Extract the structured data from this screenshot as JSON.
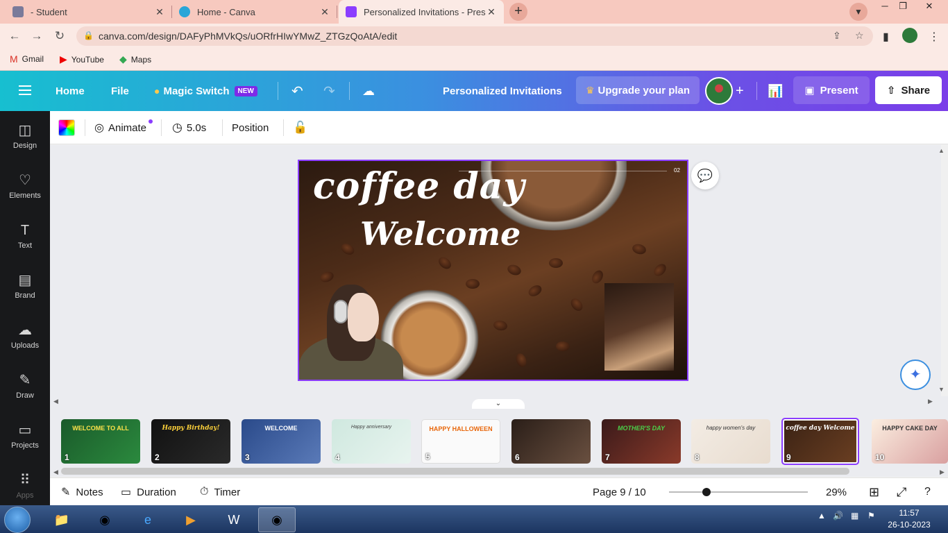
{
  "browser": {
    "tabs": [
      {
        "title": "- Student",
        "close": "✕"
      },
      {
        "title": "Home - Canva",
        "close": "✕"
      },
      {
        "title": "Personalized Invitations - Present",
        "close": "✕"
      }
    ],
    "new_tab": "+",
    "url": "canva.com/design/DAFyPhMVkQs/uORfrHIwYMwZ_ZTGzQoAtA/edit",
    "bookmarks": [
      "Gmail",
      "YouTube",
      "Maps"
    ]
  },
  "topbar": {
    "home": "Home",
    "file": "File",
    "magic_switch": "Magic Switch",
    "new_badge": "NEW",
    "doc_title": "Personalized Invitations",
    "upgrade": "Upgrade your plan",
    "plus": "+",
    "present": "Present",
    "share": "Share"
  },
  "sidebar": {
    "items": [
      {
        "label": "Design",
        "icon": "design-icon"
      },
      {
        "label": "Elements",
        "icon": "elements-icon"
      },
      {
        "label": "Text",
        "icon": "text-icon"
      },
      {
        "label": "Brand",
        "icon": "brand-icon"
      },
      {
        "label": "Uploads",
        "icon": "uploads-icon"
      },
      {
        "label": "Draw",
        "icon": "draw-icon"
      },
      {
        "label": "Projects",
        "icon": "projects-icon"
      },
      {
        "label": "Apps",
        "icon": "apps-icon"
      }
    ]
  },
  "toolbar": {
    "animate": "Animate",
    "duration": "5.0s",
    "position": "Position"
  },
  "slide": {
    "title": "coffee day",
    "subtitle": "Welcome",
    "corner_number": "02"
  },
  "thumbnails": [
    {
      "num": "1",
      "text": "WELCOME TO ALL"
    },
    {
      "num": "2",
      "text": "Happy Birthday!"
    },
    {
      "num": "3",
      "text": "WELCOME"
    },
    {
      "num": "4",
      "text": "Happy anniversary"
    },
    {
      "num": "5",
      "text": "HAPPY HALLOWEEN"
    },
    {
      "num": "6",
      "text": ""
    },
    {
      "num": "7",
      "text": "MOTHER'S DAY"
    },
    {
      "num": "8",
      "text": "happy women's day"
    },
    {
      "num": "9",
      "text": "coffee day Welcome"
    },
    {
      "num": "10",
      "text": "HAPPY CAKE DAY"
    }
  ],
  "selected_thumbnail": "9",
  "bottombar": {
    "notes": "Notes",
    "duration": "Duration",
    "timer": "Timer",
    "page": "Page 9 / 10",
    "zoom": "29%",
    "zoom_slider_fraction": 0.27
  },
  "taskbar": {
    "time": "11:57",
    "date": "26-10-2023"
  },
  "colors": {
    "accent": "#8b3dff",
    "topbar_start": "#17bfd0",
    "topbar_end": "#7a3ee8",
    "sidebar": "#18191b"
  }
}
